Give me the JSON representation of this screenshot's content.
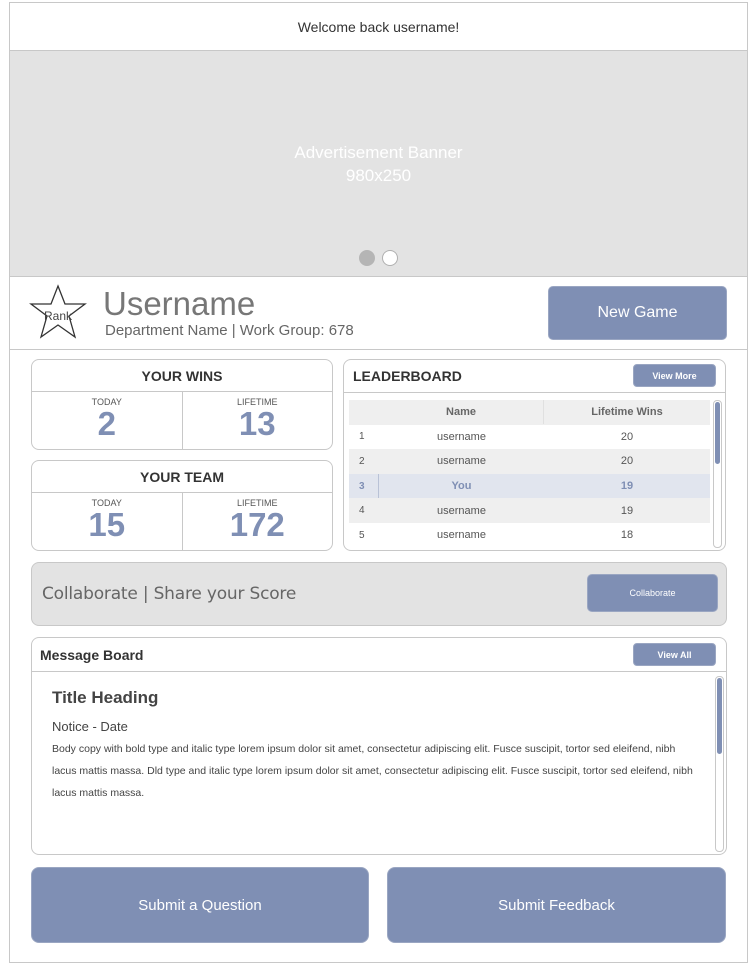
{
  "header": {
    "welcome": "Welcome back username!"
  },
  "banner": {
    "line1": "Advertisement Banner",
    "line2": "980x250",
    "slides": [
      {
        "active": true
      },
      {
        "active": false
      }
    ]
  },
  "profile": {
    "rank_label": "Rank",
    "username": "Username",
    "department": "Department Name | Work Group: 678",
    "new_game_label": "New Game"
  },
  "your_wins": {
    "title": "YOUR WINS",
    "today_label": "TODAY",
    "today_value": "2",
    "lifetime_label": "LIFETIME",
    "lifetime_value": "13"
  },
  "your_team": {
    "title": "YOUR TEAM",
    "today_label": "TODAY",
    "today_value": "15",
    "lifetime_label": "LIFETIME",
    "lifetime_value": "172"
  },
  "leaderboard": {
    "title": "LEADERBOARD",
    "view_more_label": "View More",
    "columns": [
      "",
      "Name",
      "Lifetime Wins"
    ],
    "rows": [
      {
        "rank": "1",
        "name": "username",
        "wins": "20"
      },
      {
        "rank": "2",
        "name": "username",
        "wins": "20"
      },
      {
        "rank": "3",
        "name": "You",
        "wins": "19"
      },
      {
        "rank": "4",
        "name": "username",
        "wins": "19"
      },
      {
        "rank": "5",
        "name": "username",
        "wins": "18"
      }
    ]
  },
  "collaborate": {
    "text": "Collaborate | Share your Score",
    "button_label": "Collaborate"
  },
  "message_board": {
    "title": "Message Board",
    "view_all_label": "View All",
    "post_title": "Title Heading",
    "notice": "Notice - Date",
    "body": "Body copy with bold type and italic type lorem ipsum dolor sit amet, consectetur adipiscing elit. Fusce suscipit, tortor sed eleifend, nibh lacus mattis massa. Dld type and italic type lorem ipsum dolor sit amet, consectetur adipiscing elit. Fusce suscipit, tortor sed eleifend, nibh lacus mattis massa."
  },
  "actions": {
    "submit_question_label": "Submit a Question",
    "submit_feedback_label": "Submit Feedback"
  },
  "colors": {
    "accent": "#7f8fb4",
    "panel_gray": "#e3e3e3",
    "border": "#c8c8c8"
  }
}
